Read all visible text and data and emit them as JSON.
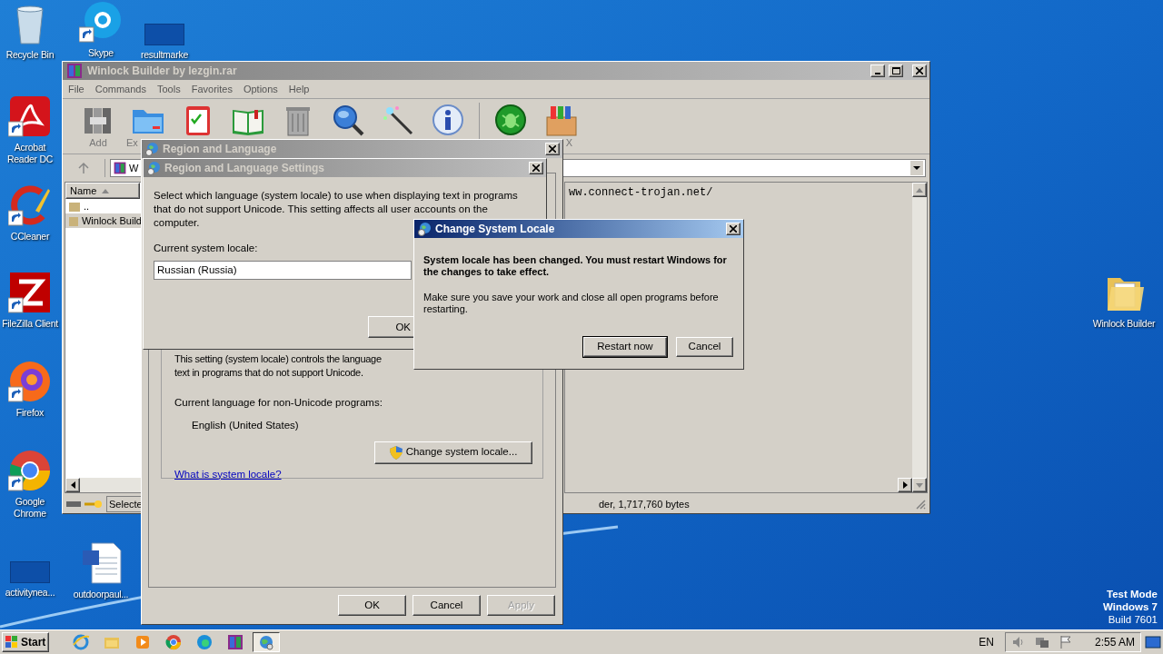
{
  "desktop_icons": [
    {
      "label": "Recycle Bin",
      "kind": "recycle",
      "shortcut": false
    },
    {
      "label": "Skype",
      "kind": "skype",
      "shortcut": true
    },
    {
      "label": "resultmarke",
      "kind": "blank",
      "shortcut": false
    },
    {
      "label": "Acrobat Reader DC",
      "kind": "acrobat",
      "shortcut": true
    },
    {
      "label": "CCleaner",
      "kind": "ccleaner",
      "shortcut": true
    },
    {
      "label": "FileZilla Client",
      "kind": "filezilla",
      "shortcut": true
    },
    {
      "label": "Firefox",
      "kind": "firefox",
      "shortcut": true
    },
    {
      "label": "Google Chrome",
      "kind": "chrome",
      "shortcut": true
    },
    {
      "label": "activitynea...",
      "kind": "blank",
      "shortcut": false
    },
    {
      "label": "outdoorpaul...",
      "kind": "word",
      "shortcut": false
    },
    {
      "label": "Winlock Builder",
      "kind": "folder",
      "shortcut": false
    }
  ],
  "archive_window": {
    "title": "Winlock Builder by lezgin.rar",
    "menu": [
      "File",
      "Commands",
      "Tools",
      "Favorites",
      "Options",
      "Help"
    ],
    "toolbar": [
      {
        "kind": "add",
        "label": "Add"
      },
      {
        "kind": "extract",
        "label": "Ex"
      },
      {
        "kind": "test"
      },
      {
        "kind": "view"
      },
      {
        "kind": "delete"
      },
      {
        "kind": "find"
      },
      {
        "kind": "wizard"
      },
      {
        "kind": "info"
      },
      {
        "kind": "virus"
      },
      {
        "kind": "sfx",
        "label": "X"
      }
    ],
    "address": "W",
    "column": "Name",
    "files": [
      {
        "name": "..",
        "selected": false
      },
      {
        "name": "Winlock Build",
        "selected": true
      }
    ],
    "comment": "ww.connect-trojan.net/",
    "status_left": "Selecte",
    "status_right": "der, 1,717,760 bytes"
  },
  "region_window": {
    "title": "Region and Language",
    "description": [
      "This setting (system locale) controls the language",
      "text in programs that do not support Unicode."
    ],
    "current_language_label": "Current language for non-Unicode programs:",
    "current_language": "English (United States)",
    "change_button": "Change system locale...",
    "help_link": "What is system locale?",
    "buttons": [
      {
        "label": "OK",
        "disabled": false
      },
      {
        "label": "Cancel",
        "disabled": false
      },
      {
        "label": "Apply",
        "disabled": true
      }
    ]
  },
  "settings_dialog": {
    "title": "Region and Language Settings",
    "text_lines": [
      "Select which language (system locale) to use when displaying text in programs",
      "that do not support Unicode. This setting affects all user accounts on the",
      "computer."
    ],
    "locale_label": "Current system locale:",
    "locale_value": "Russian (Russia)",
    "ok_button": "OK"
  },
  "locale_dialog": {
    "title": "Change System Locale",
    "message": "System locale has been changed. You must restart Windows for the changes to take effect.",
    "note": "Make sure you save your work and close all open programs before restarting.",
    "buttons": [
      {
        "label": "Restart now",
        "default": true
      },
      {
        "label": "Cancel",
        "default": false
      }
    ]
  },
  "os_notice": [
    "Test Mode",
    "Windows 7",
    "Build 7601"
  ],
  "taskbar": {
    "start": "Start",
    "apps": [
      {
        "kind": "ie",
        "selected": false
      },
      {
        "kind": "explorer",
        "selected": false
      },
      {
        "kind": "media",
        "selected": false
      },
      {
        "kind": "chrome",
        "selected": false
      },
      {
        "kind": "edge",
        "selected": false
      },
      {
        "kind": "winrar",
        "selected": false
      },
      {
        "kind": "globe",
        "selected": true
      }
    ],
    "language": "EN",
    "time": "2:55 AM"
  }
}
